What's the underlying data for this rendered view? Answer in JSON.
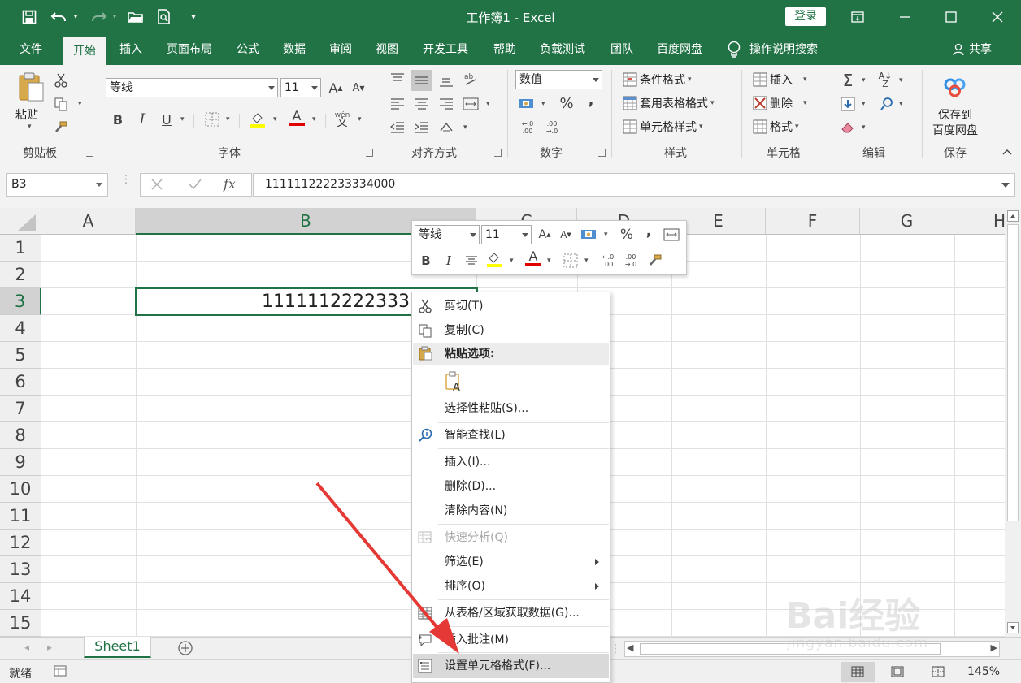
{
  "window": {
    "title": "工作簿1  -  Excel",
    "login_label": "登录"
  },
  "tabs": [
    {
      "label": "文件"
    },
    {
      "label": "开始"
    },
    {
      "label": "插入"
    },
    {
      "label": "页面布局"
    },
    {
      "label": "公式"
    },
    {
      "label": "数据"
    },
    {
      "label": "审阅"
    },
    {
      "label": "视图"
    },
    {
      "label": "开发工具"
    },
    {
      "label": "帮助"
    },
    {
      "label": "负载测试"
    },
    {
      "label": "团队"
    },
    {
      "label": "百度网盘"
    }
  ],
  "tell_me": "操作说明搜索",
  "share_label": "共享",
  "ribbon": {
    "clipboard": {
      "paste_label": "粘贴",
      "group_label": "剪贴板"
    },
    "font": {
      "font_name": "等线",
      "font_size": "11",
      "group_label": "字体",
      "grow": "A",
      "shrink": "A",
      "bold": "B",
      "italic": "I",
      "underline": "U",
      "font_color_letter": "A",
      "phonetic": "wén"
    },
    "alignment": {
      "group_label": "对齐方式"
    },
    "number": {
      "format": "数值",
      "percent": "%",
      "comma": ",",
      "group_label": "数字"
    },
    "styles": {
      "conditional": "条件格式",
      "table": "套用表格格式",
      "cell_styles": "单元格样式",
      "group_label": "样式"
    },
    "cells": {
      "insert": "插入",
      "delete": "删除",
      "format": "格式",
      "group_label": "单元格"
    },
    "editing": {
      "group_label": "编辑"
    },
    "save": {
      "line1": "保存到",
      "line2": "百度网盘",
      "group_label": "保存"
    }
  },
  "formula_bar": {
    "name_box": "B3",
    "fx": "fx",
    "formula": "111111222233334000"
  },
  "columns": [
    "A",
    "B",
    "C",
    "D",
    "E",
    "F",
    "G",
    "H"
  ],
  "rows": [
    "1",
    "2",
    "3",
    "4",
    "5",
    "6",
    "7",
    "8",
    "9",
    "10",
    "11",
    "12",
    "13",
    "14",
    "15"
  ],
  "cell_b3": "111111222233334000",
  "mini_toolbar": {
    "font_name": "等线",
    "font_size": "11",
    "bold": "B",
    "italic": "I",
    "percent": "%",
    "comma": ",",
    "font_color_letter": "A"
  },
  "context_menu": [
    {
      "label": "剪切(T)",
      "icon": "scissors-icon"
    },
    {
      "label": "复制(C)",
      "icon": "copy-icon"
    },
    {
      "label": "粘贴选项:",
      "icon": "clipboard-icon",
      "header": true
    },
    {
      "label": "",
      "icon": "paste-text-icon"
    },
    {
      "label": "选择性粘贴(S)...",
      "icon": ""
    },
    {
      "label": "智能查找(L)",
      "icon": "smart-lookup-icon"
    },
    {
      "label": "插入(I)...",
      "icon": ""
    },
    {
      "label": "删除(D)...",
      "icon": ""
    },
    {
      "label": "清除内容(N)",
      "icon": ""
    },
    {
      "label": "快速分析(Q)",
      "icon": "quick-analysis-icon",
      "disabled": true
    },
    {
      "label": "筛选(E)",
      "icon": "",
      "submenu": true
    },
    {
      "label": "排序(O)",
      "icon": "",
      "submenu": true
    },
    {
      "label": "从表格/区域获取数据(G)...",
      "icon": "table-icon"
    },
    {
      "label": "插入批注(M)",
      "icon": "comment-icon"
    },
    {
      "label": "设置单元格格式(F)...",
      "icon": "format-cells-icon",
      "highlighted": true
    }
  ],
  "sheet_tab": "Sheet1",
  "status": {
    "ready": "就绪",
    "zoom": "145%"
  },
  "watermark": {
    "brand": "Bai经验",
    "url": "jingyan.baidu.com"
  },
  "colors": {
    "excel_green": "#217346",
    "arrow_red": "#e53935"
  }
}
